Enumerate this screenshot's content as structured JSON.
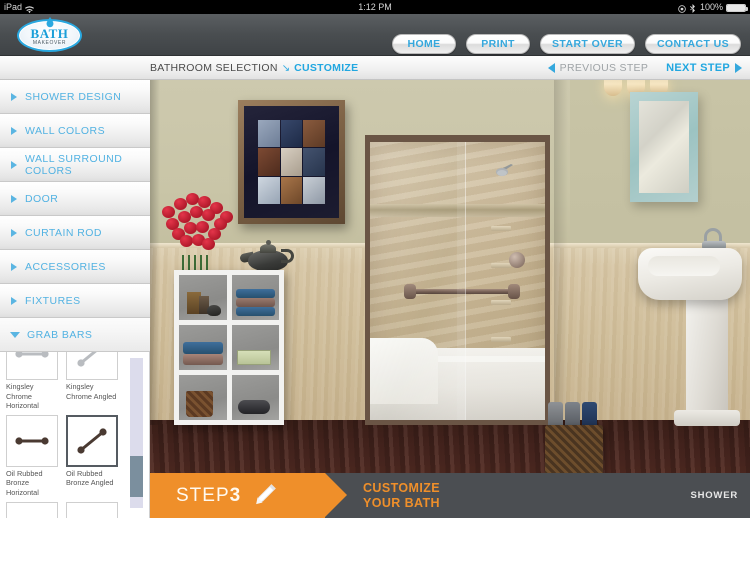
{
  "status_bar": {
    "device": "iPad",
    "wifi_icon": "wifi-icon",
    "time": "1:12 PM",
    "rotation_lock_icon": "rotation-lock-icon",
    "bluetooth_icon": "bluetooth-icon",
    "battery_percent": "100%",
    "battery_icon": "battery-full-icon"
  },
  "header": {
    "logo": {
      "title": "BATH",
      "subtitle": "MAKEOVER",
      "droplet_icon": "water-droplet-icon"
    },
    "buttons": [
      {
        "label": "HOME",
        "name": "home-button"
      },
      {
        "label": "PRINT",
        "name": "print-button"
      },
      {
        "label": "START OVER",
        "name": "start-over-button"
      },
      {
        "label": "CONTACT US",
        "name": "contact-us-button"
      }
    ]
  },
  "breadcrumb": {
    "parent": "BATHROOM SELECTION",
    "arrow_icon": "arrow-down-right-icon",
    "current": "CUSTOMIZE"
  },
  "step_nav": {
    "previous_label": "PREVIOUS STEP",
    "previous_icon": "triangle-left-icon",
    "next_label": "NEXT STEP",
    "next_icon": "triangle-right-icon"
  },
  "sidebar": {
    "items": [
      {
        "label": "SHOWER DESIGN",
        "expanded": false
      },
      {
        "label": "WALL COLORS",
        "expanded": false
      },
      {
        "label": "WALL SURROUND COLORS",
        "expanded": false
      },
      {
        "label": "DOOR",
        "expanded": false
      },
      {
        "label": "CURTAIN ROD",
        "expanded": false
      },
      {
        "label": "ACCESSORIES",
        "expanded": false
      },
      {
        "label": "FIXTURES",
        "expanded": false
      },
      {
        "label": "GRAB BARS",
        "expanded": true
      }
    ],
    "grab_bars_panel": {
      "options": [
        {
          "label": "Kingsley Chrome Horizontal",
          "selected": false,
          "style": "horizontal",
          "color": "#b9bcc0"
        },
        {
          "label": "Kingsley Chrome Angled",
          "selected": false,
          "style": "angled",
          "color": "#b9bcc0"
        },
        {
          "label": "Oil Rubbed Bronze Horizontal",
          "selected": false,
          "style": "horizontal",
          "color": "#4a3a32"
        },
        {
          "label": "Oil Rubbed Bronze Angled",
          "selected": true,
          "style": "angled",
          "color": "#4a3a32"
        }
      ],
      "scrollbar": {
        "track_color": "#dcdcec",
        "thumb_color": "#7b8f9e"
      }
    }
  },
  "step_banner": {
    "step_word": "STEP",
    "step_number": "3",
    "pencil_icon": "pencil-icon",
    "headline_line1": "CUSTOMIZE",
    "headline_line2": "YOUR BATH",
    "right_label": "SHOWER"
  },
  "colors": {
    "accent_blue": "#21a7e0",
    "orange": "#ef8f2a",
    "header_gray": "#4a4e51",
    "banner_gray": "#4b4e52"
  },
  "scene": {
    "name": "bathroom-preview",
    "elements": [
      "framed-wall-art",
      "red-roses-vase",
      "teapot",
      "white-cube-shelf",
      "shower-enclosure",
      "glass-shower-doors",
      "oil-rubbed-bronze-grab-bar",
      "shower-head",
      "corner-shelves",
      "bath-mat",
      "wicker-towel-basket",
      "pedestal-sink",
      "chrome-faucet",
      "teal-framed-mirror",
      "vanity-light"
    ]
  }
}
